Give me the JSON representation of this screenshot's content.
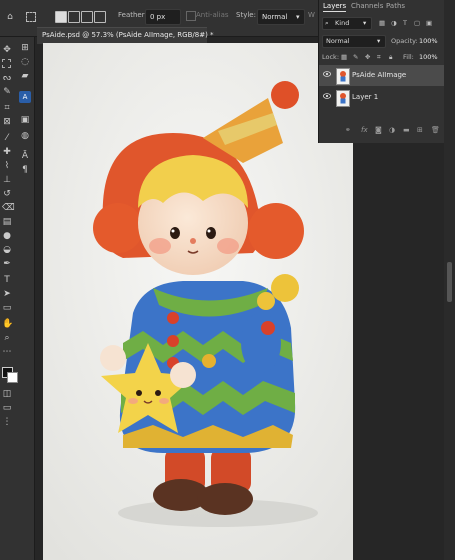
{
  "options_bar": {
    "feather_label": "Feather:",
    "feather_value": "0 px",
    "antialias_label": "Anti-alias",
    "style_label": "Style:",
    "style_value": "Normal",
    "width_label": "W"
  },
  "document": {
    "tab_title": "PsAide.psd @ 57.3% (PsAide AIImage, RGB/8#) *"
  },
  "layers_panel": {
    "tabs": [
      "Layers",
      "Channels",
      "Paths"
    ],
    "active_tab": "Layers",
    "filter_kind": "Kind",
    "blend_mode": "Normal",
    "opacity_label": "Opacity:",
    "opacity_value": "100%",
    "lock_label": "Lock:",
    "fill_label": "Fill:",
    "fill_value": "100%",
    "layers": [
      {
        "name": "PsAide AIImage",
        "visible": true,
        "selected": true
      },
      {
        "name": "Layer 1",
        "visible": true,
        "selected": false
      }
    ],
    "footer_fx_label": "fx"
  },
  "colors": {
    "app_bg": "#262626",
    "panel_bg": "#323232",
    "selected_layer": "#4b4b4b",
    "canvas_bg": "#eeeeea"
  }
}
